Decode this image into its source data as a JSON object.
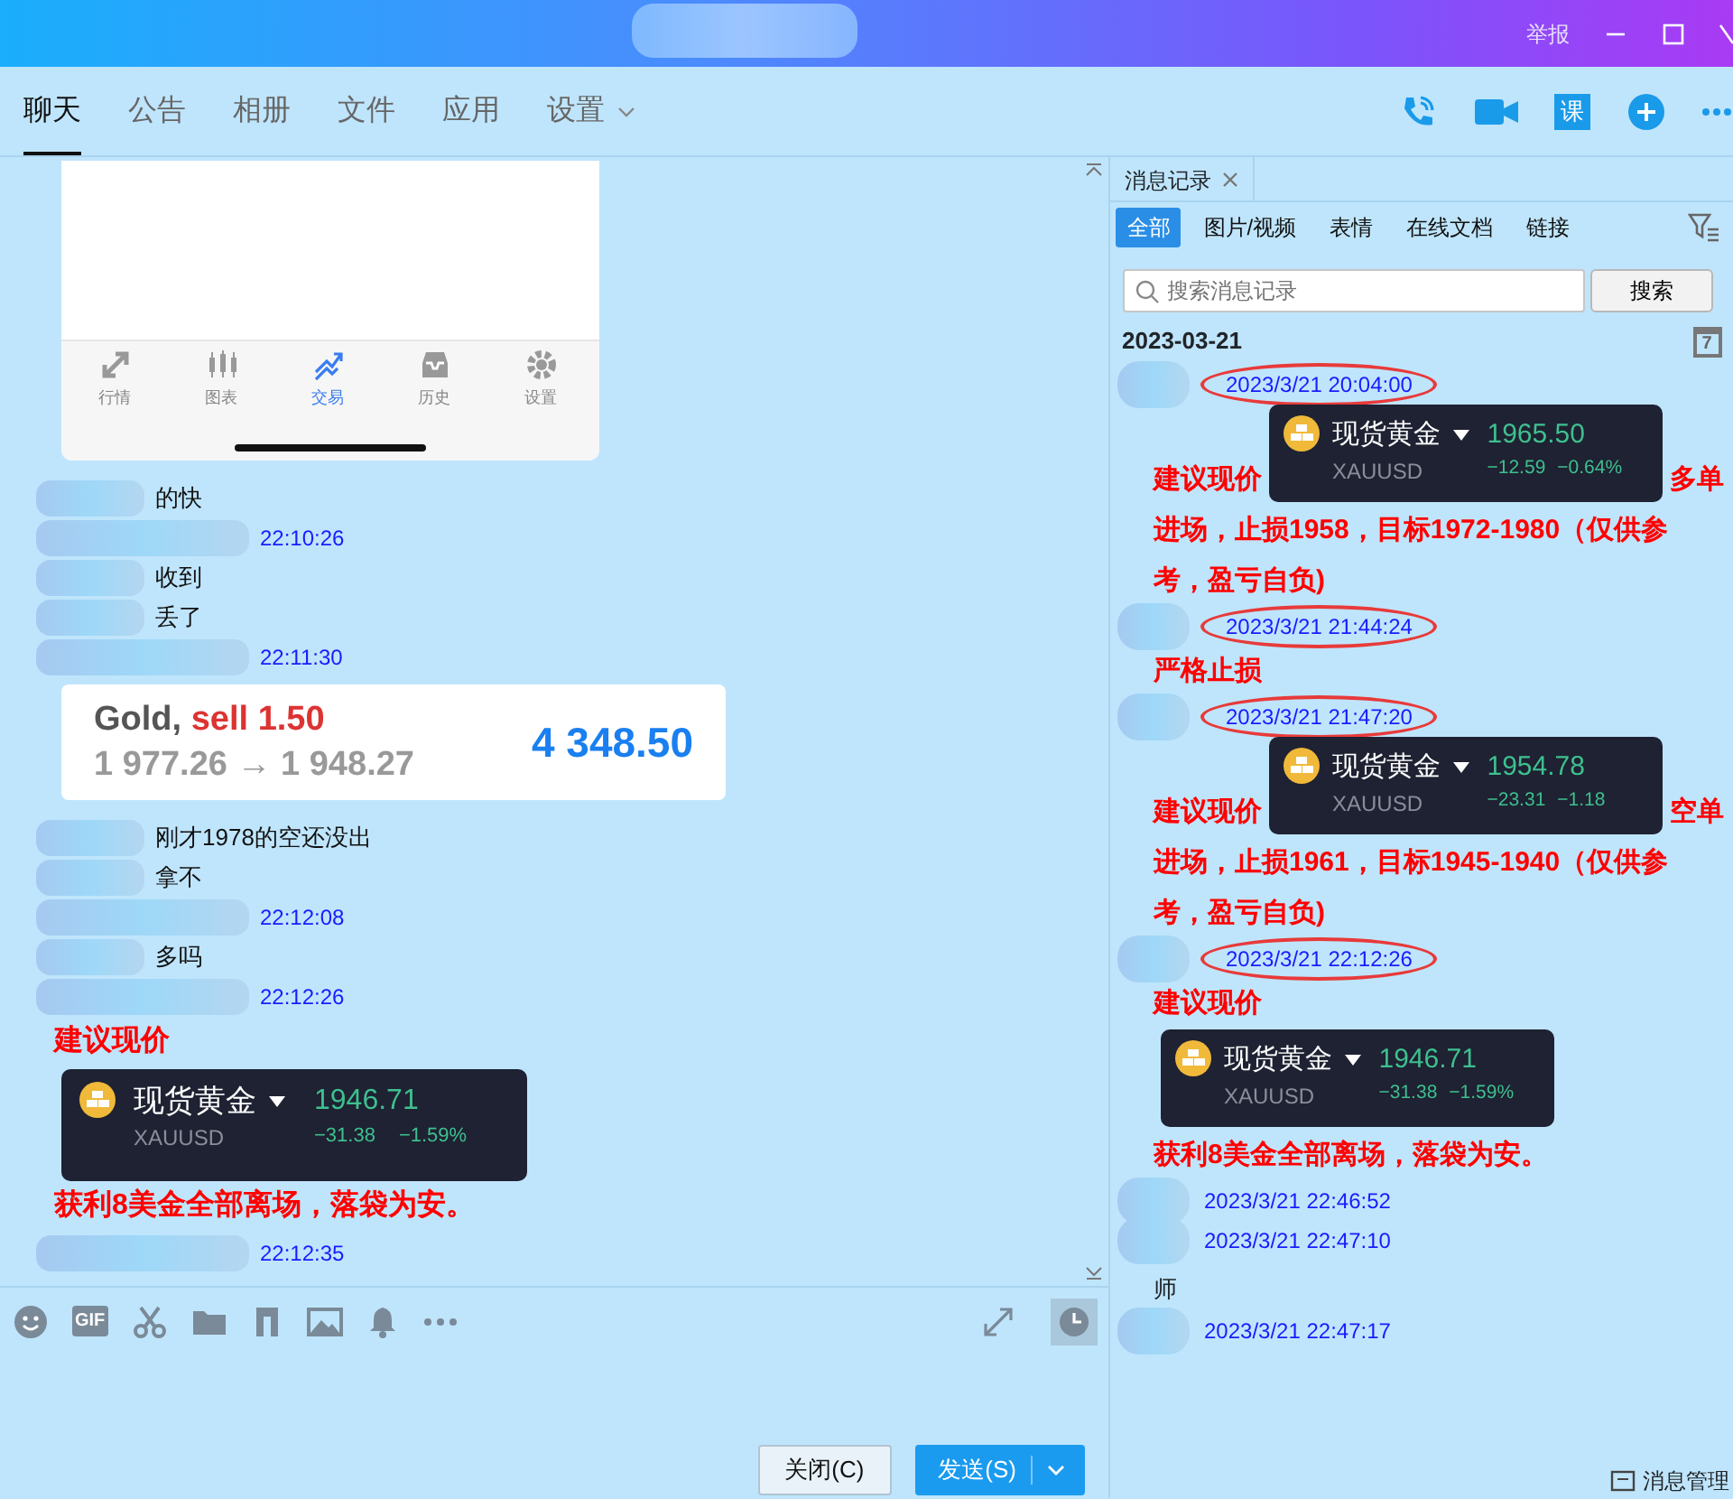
{
  "title_bar": {
    "report": "举报"
  },
  "tabs": [
    {
      "label": "聊天",
      "selected": true,
      "dropdown": false
    },
    {
      "label": "公告",
      "selected": false,
      "dropdown": false
    },
    {
      "label": "相册",
      "selected": false,
      "dropdown": false
    },
    {
      "label": "文件",
      "selected": false,
      "dropdown": false
    },
    {
      "label": "应用",
      "selected": false,
      "dropdown": false
    },
    {
      "label": "设置",
      "selected": false,
      "dropdown": true
    }
  ],
  "course_badge": "课",
  "chat": {
    "messages": [
      {
        "kind": "app_screenshot",
        "tabs": [
          {
            "label": "行情",
            "selected": false
          },
          {
            "label": "图表",
            "selected": false
          },
          {
            "label": "交易",
            "selected": true
          },
          {
            "label": "历史",
            "selected": false
          },
          {
            "label": "设置",
            "selected": false
          }
        ]
      },
      {
        "kind": "text",
        "text": "的快"
      },
      {
        "kind": "time",
        "time": "22:10:26"
      },
      {
        "kind": "text",
        "text": "收到"
      },
      {
        "kind": "text",
        "text": "丢了"
      },
      {
        "kind": "time",
        "time": "22:11:30"
      },
      {
        "kind": "trade",
        "symbol": "Gold,",
        "action": "sell 1.50",
        "prices": "1 977.26 → 1 948.27",
        "profit": "4 348.50"
      },
      {
        "kind": "text",
        "text": "刚才1978的空还没出"
      },
      {
        "kind": "text",
        "text": "拿不"
      },
      {
        "kind": "time",
        "time": "22:12:08"
      },
      {
        "kind": "text",
        "text": "多吗"
      },
      {
        "kind": "time",
        "time": "22:12:26"
      },
      {
        "kind": "signal",
        "text": "建议现价"
      },
      {
        "kind": "ticker",
        "name": "现货黄金",
        "code": "XAUUSD",
        "price": "1946.71",
        "change": "−31.38",
        "percent": "−1.59%"
      },
      {
        "kind": "signal",
        "text": "获利8美金全部离场，落袋为安。"
      },
      {
        "kind": "time",
        "time": "22:12:35"
      }
    ]
  },
  "composer": {
    "gif_label": "GIF",
    "buttons": [
      {
        "label": "关闭(C)",
        "kind": "secondary"
      },
      {
        "label": "发送(S)",
        "kind": "primary"
      }
    ]
  },
  "history": {
    "tab": "消息记录",
    "filters": [
      {
        "label": "全部",
        "selected": true
      },
      {
        "label": "图片/视频",
        "selected": false
      },
      {
        "label": "表情",
        "selected": false
      },
      {
        "label": "在线文档",
        "selected": false
      },
      {
        "label": "链接",
        "selected": false
      }
    ],
    "search": {
      "placeholder": "搜索消息记录",
      "button": "搜索"
    },
    "date": "2023-03-21",
    "calendar_day": "7",
    "entries": [
      {
        "time": "2023/3/21 20:04:00",
        "circled": true,
        "lines": [
          [
            {
              "kind": "signal",
              "text": "建议现价"
            },
            {
              "kind": "ticker",
              "name": "现货黄金",
              "code": "XAUUSD",
              "price": "1965.50",
              "change": "−12.59",
              "percent": "−0.64%"
            },
            {
              "kind": "signal",
              "text": "多单"
            }
          ],
          [
            {
              "kind": "signal",
              "text": "进场，止损1958，目标1972-1980（仅供参"
            }
          ],
          [
            {
              "kind": "signal",
              "text": "考，盈亏自负)"
            }
          ]
        ]
      },
      {
        "time": "2023/3/21 21:44:24",
        "circled": true,
        "lines": [
          [
            {
              "kind": "signal",
              "text": "严格止损"
            }
          ]
        ]
      },
      {
        "time": "2023/3/21 21:47:20",
        "circled": true,
        "lines": [
          [
            {
              "kind": "signal",
              "text": "建议现价"
            },
            {
              "kind": "ticker",
              "name": "现货黄金",
              "code": "XAUUSD",
              "price": "1954.78",
              "change": "−23.31",
              "percent": "−1.18"
            },
            {
              "kind": "signal",
              "text": "空单"
            }
          ],
          [
            {
              "kind": "signal",
              "text": "进场，止损1961，目标1945-1940（仅供参"
            }
          ],
          [
            {
              "kind": "signal",
              "text": "考，盈亏自负)"
            }
          ]
        ]
      },
      {
        "time": "2023/3/21 22:12:26",
        "circled": true,
        "lines": [
          [
            {
              "kind": "signal",
              "text": "建议现价"
            }
          ],
          [
            {
              "kind": "ticker",
              "name": "现货黄金",
              "code": "XAUUSD",
              "price": "1946.71",
              "change": "−31.38",
              "percent": "−1.59%"
            }
          ],
          [
            {
              "kind": "signal",
              "text": "获利8美金全部离场，落袋为安。"
            }
          ]
        ]
      },
      {
        "time": "2023/3/21 22:46:52",
        "circled": false
      },
      {
        "time": "2023/3/21 22:47:10",
        "circled": false,
        "lines": [
          [
            {
              "kind": "text",
              "text": "师"
            }
          ]
        ]
      },
      {
        "time": "2023/3/21 22:47:17",
        "circled": false
      }
    ],
    "footer": "消息管理"
  }
}
